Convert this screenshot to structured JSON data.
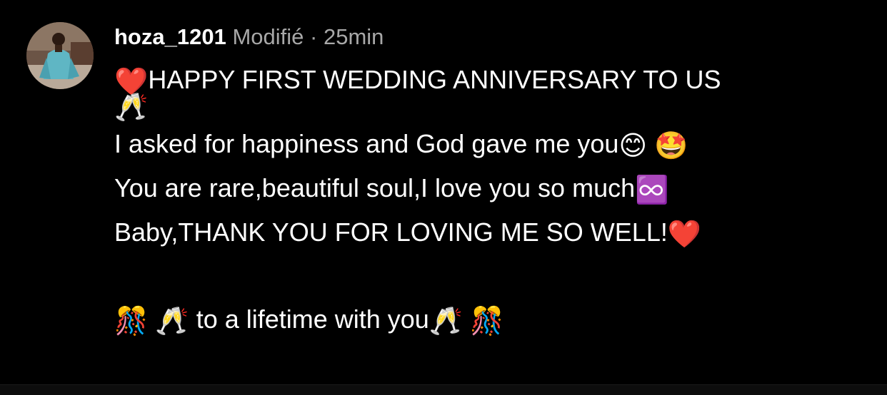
{
  "post": {
    "username": "hoza_1201",
    "edited_label": "Modifié",
    "separator": "·",
    "time_ago": "25min"
  },
  "caption": {
    "line1_emoji": "❤️",
    "line1_text": "HAPPY FIRST WEDDING ANNIVERSARY TO US",
    "line1_end_emoji": "🥂",
    "line2_text": "I asked for happiness and God gave me you",
    "line2_emoji_a": "😊",
    "line2_emoji_b": "🤩",
    "line3_text": "You are rare,beautiful soul,I love you so much",
    "line3_emoji": "♾️",
    "line4_text": "Baby,THANK YOU FOR LOVING ME SO WELL!",
    "line4_emoji": "❤️",
    "line5_emoji_a": "🎊",
    "line5_emoji_b": "🥂",
    "line5_text": "to a lifetime with you",
    "line5_emoji_c": "🥂",
    "line5_emoji_d": "🎊"
  },
  "colors": {
    "background": "#000000",
    "text": "#ffffff",
    "meta": "#a8a8a8"
  },
  "icons": {
    "avatar": "profile-photo"
  }
}
